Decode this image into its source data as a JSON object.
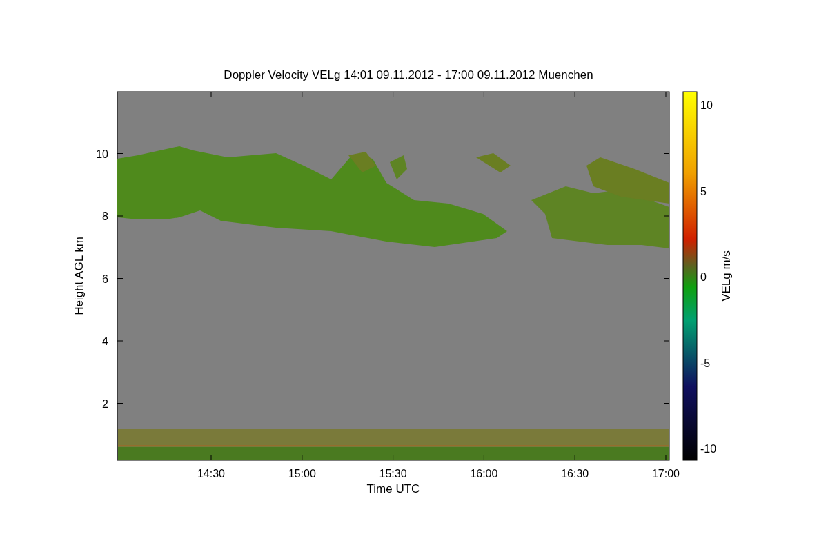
{
  "title": "Doppler Velocity VELg   14:01 09.11.2012 - 17:00 09.11.2012 Muenchen",
  "y_axis": {
    "label": "Height AGL km",
    "ticks": [
      "10",
      "8",
      "6",
      "4",
      "2"
    ]
  },
  "x_axis": {
    "label": "Time UTC",
    "ticks": [
      "14:30",
      "15:00",
      "15:30",
      "16:00",
      "16:30",
      "17:00"
    ]
  },
  "colorbar": {
    "label": "VELg m/s",
    "ticks": [
      "10",
      "5",
      "0",
      "-5",
      "-10"
    ]
  }
}
